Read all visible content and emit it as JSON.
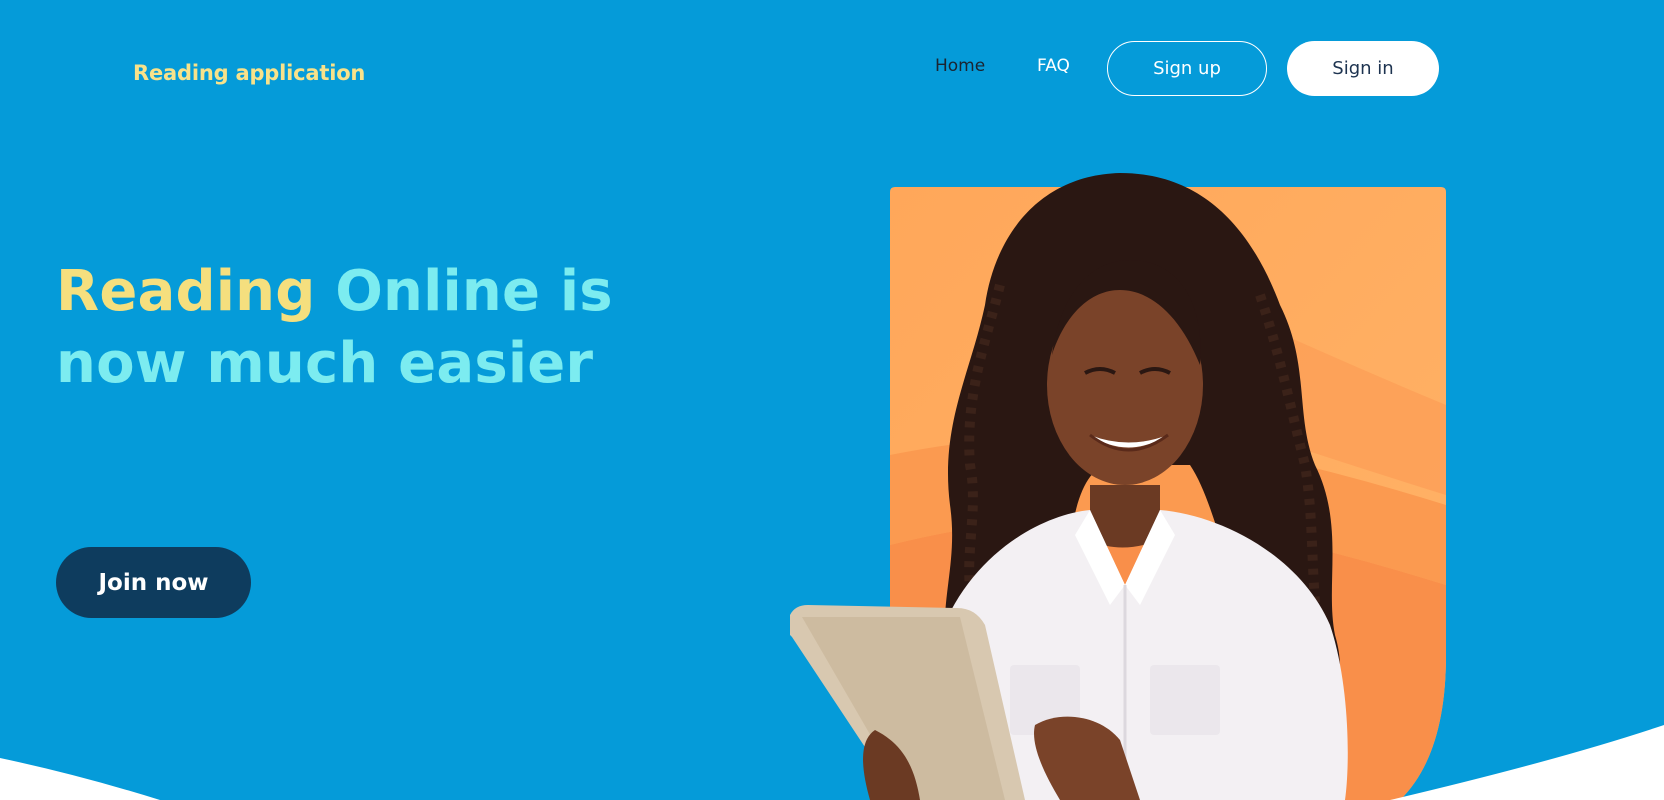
{
  "header": {
    "brand": "Reading application",
    "nav": {
      "home": "Home",
      "faq": "FAQ",
      "signup": "Sign up",
      "signin": "Sign in"
    }
  },
  "hero": {
    "title_highlight": "Reading",
    "title_rest_line1": " Online is",
    "title_line2": "now much easier",
    "join_label": "Join now",
    "image_alt": "woman-with-tablet"
  },
  "colors": {
    "background": "#059bd9",
    "brand": "#f8e28a",
    "title": "#7cecf0",
    "highlight": "#f5df7e",
    "join_button": "#0e3c5e",
    "photo_card": "#ffa95a"
  }
}
